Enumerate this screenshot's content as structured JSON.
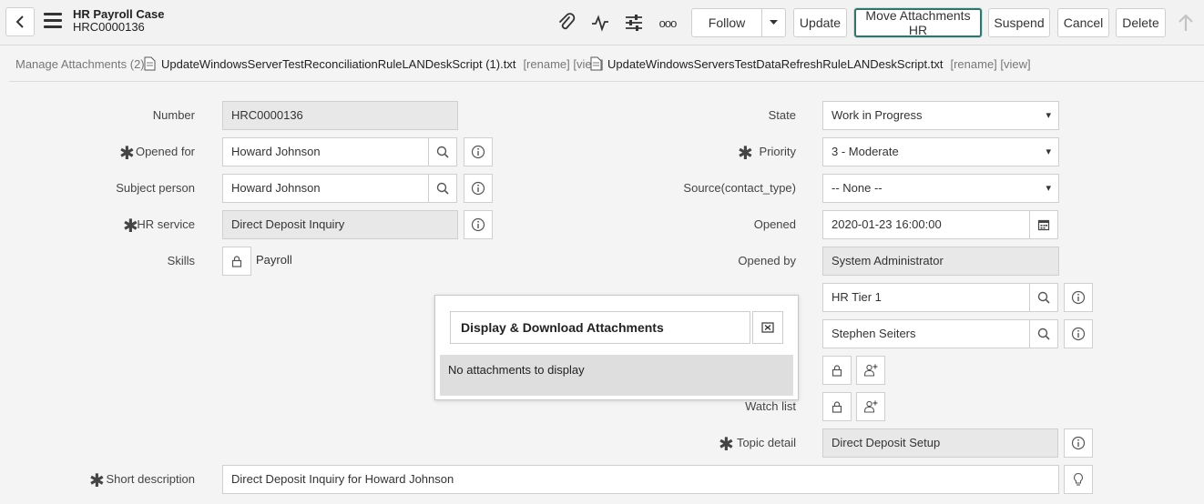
{
  "header": {
    "title": "HR Payroll Case",
    "number": "HRC0000136",
    "follow_label": "Follow",
    "update_label": "Update",
    "move_label": "Move Attachments HR",
    "suspend_label": "Suspend",
    "cancel_label": "Cancel",
    "delete_label": "Delete",
    "more_label": "ooo"
  },
  "attachments": {
    "label": "Manage Attachments (2):",
    "files": [
      {
        "name": "UpdateWindowsServerTestReconciliationRuleLANDeskScript (1).txt",
        "actions": "[rename] [view]"
      },
      {
        "name": "UpdateWindowsServersTestDataRefreshRuleLANDeskScript.txt",
        "actions": "[rename] [view]"
      }
    ]
  },
  "form": {
    "number_label": "Number",
    "number_value": "HRC0000136",
    "opened_for_label": "Opened for",
    "opened_for_value": "Howard Johnson",
    "subject_person_label": "Subject person",
    "subject_person_value": "Howard Johnson",
    "hr_service_label": "HR service",
    "hr_service_value": "Direct Deposit Inquiry",
    "skills_label": "Skills",
    "skills_value": "Payroll",
    "short_desc_label": "Short description",
    "short_desc_value": "Direct Deposit Inquiry for Howard Johnson",
    "state_label": "State",
    "state_value": "Work in Progress",
    "priority_label": "Priority",
    "priority_value": "3 - Moderate",
    "source_label": "Source(contact_type)",
    "source_value": "-- None --",
    "opened_label": "Opened",
    "opened_value": "2020-01-23 16:00:00",
    "opened_by_label": "Opened by",
    "opened_by_value": "System Administrator",
    "assignment_group_value": "HR Tier 1",
    "assigned_to_value": "Stephen Seiters",
    "watch_list_label": "Watch list",
    "topic_detail_label": "Topic detail",
    "topic_detail_value": "Direct Deposit Setup"
  },
  "popup": {
    "title": "Display & Download Attachments",
    "empty_message": "No attachments to display"
  },
  "colors": {
    "accent": "#3c6f6a",
    "readonly_bg": "#e8e8e8",
    "page_bg": "#f4f4f4"
  }
}
